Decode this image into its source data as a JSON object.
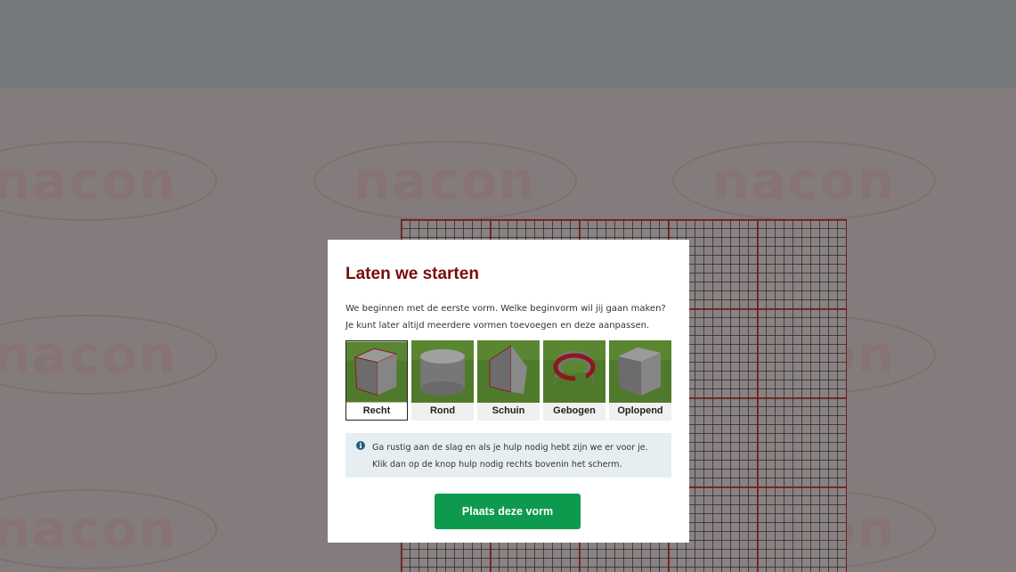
{
  "watermark": {
    "text": "nacon"
  },
  "modal": {
    "title": "Laten we starten",
    "description": "We beginnen met de eerste vorm. Welke beginvorm wil jij gaan maken? Je kunt later altijd meerdere vormen toevoegen en deze aanpassen.",
    "shapes": [
      {
        "label": "Recht",
        "icon": "cube-shape-icon",
        "selected": true
      },
      {
        "label": "Rond",
        "icon": "cylinder-shape-icon",
        "selected": false
      },
      {
        "label": "Schuin",
        "icon": "slanted-shape-icon",
        "selected": false
      },
      {
        "label": "Gebogen",
        "icon": "curved-shape-icon",
        "selected": false
      },
      {
        "label": "Oplopend",
        "icon": "ascending-shape-icon",
        "selected": false
      }
    ],
    "info": {
      "icon": "info-icon",
      "line1": "Ga rustig aan de slag en als je hulp nodig hebt zijn we er voor je.",
      "line2": "Klik dan op de knop hulp nodig rechts bovenin het scherm."
    },
    "button_label": "Plaats deze vorm"
  },
  "colors": {
    "title": "#7a0c0c",
    "button": "#0e9a4e",
    "info_bg": "#e7eef1"
  }
}
